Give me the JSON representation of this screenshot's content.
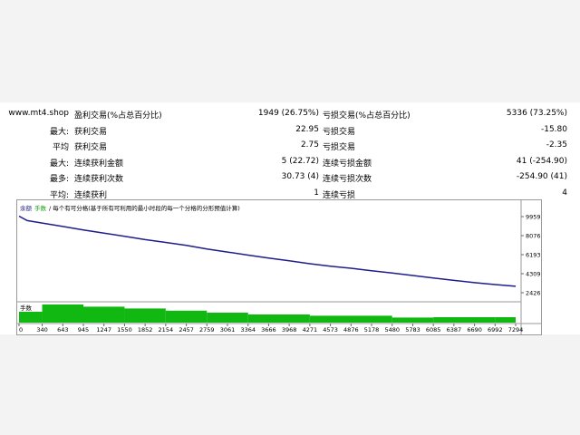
{
  "stats": {
    "rows": [
      {
        "label": "www.mt4.shop",
        "t1": "盈利交易(%占总百分比)",
        "v1": "1949 (26.75%)",
        "t2": "亏损交易(%占总百分比)",
        "v2": "5336 (73.25%)"
      },
      {
        "label": "最大:",
        "t1": "获利交易",
        "v1": "22.95",
        "t2": "亏损交易",
        "v2": "-15.80"
      },
      {
        "label": "平均",
        "t1": "获利交易",
        "v1": "2.75",
        "t2": "亏损交易",
        "v2": "-2.35"
      },
      {
        "label": "最大:",
        "t1": "连续获利金额",
        "v1": "5 (22.72)",
        "t2": "连续亏损金额",
        "v2": "41 (-254.90)"
      },
      {
        "label": "最多:",
        "t1": "连续获利次数",
        "v1": "30.73 (4)",
        "t2": "连续亏损次数",
        "v2": "-254.90 (41)"
      },
      {
        "label": "平均:",
        "t1": "连续获利",
        "v1": "1",
        "t2": "连续亏损",
        "v2": "4"
      }
    ]
  },
  "chart": {
    "header_balance": "余额",
    "header_lots": "手数",
    "header_rest": "/ 每个有可分格(基于所有可利用的最小时段的每一个分格的分形预值计算)",
    "volume_label": "手数"
  },
  "colors": {
    "line": "#1e1e8c",
    "volume": "#11b811",
    "grid": "#cfcfcf"
  },
  "chart_data": {
    "type": "line",
    "x_ticks": [
      "0",
      "340",
      "643",
      "945",
      "1247",
      "1550",
      "1852",
      "2154",
      "2457",
      "2759",
      "3061",
      "3364",
      "3666",
      "3968",
      "4271",
      "4573",
      "4876",
      "5178",
      "5480",
      "5783",
      "6085",
      "6387",
      "6690",
      "6992",
      "7294"
    ],
    "y_ticks": [
      "9959",
      "8076",
      "6193",
      "4309",
      "2426"
    ],
    "ylim": [
      2426,
      9959
    ],
    "xlim": [
      0,
      7294
    ],
    "series": [
      {
        "x": [
          0,
          120,
          340,
          643,
          945,
          1247,
          1550,
          1852,
          2154,
          2457,
          2759,
          3061,
          3364,
          3666,
          3968,
          4271,
          4573,
          4876,
          5178,
          5480,
          5783,
          6085,
          6387,
          6690,
          6992,
          7294
        ],
        "values": [
          10000,
          9560,
          9320,
          8980,
          8640,
          8330,
          8000,
          7680,
          7400,
          7120,
          6760,
          6450,
          6150,
          5860,
          5580,
          5300,
          5050,
          4850,
          4600,
          4370,
          4130,
          3880,
          3650,
          3420,
          3230,
          3060
        ]
      }
    ],
    "volume": {
      "x": [
        0,
        340,
        945,
        1550,
        2154,
        2759,
        3364,
        4271,
        5480,
        6085,
        6992,
        7294
      ],
      "values": [
        0.6,
        1.0,
        0.88,
        0.78,
        0.66,
        0.55,
        0.45,
        0.38,
        0.28,
        0.3,
        0.3
      ]
    }
  }
}
